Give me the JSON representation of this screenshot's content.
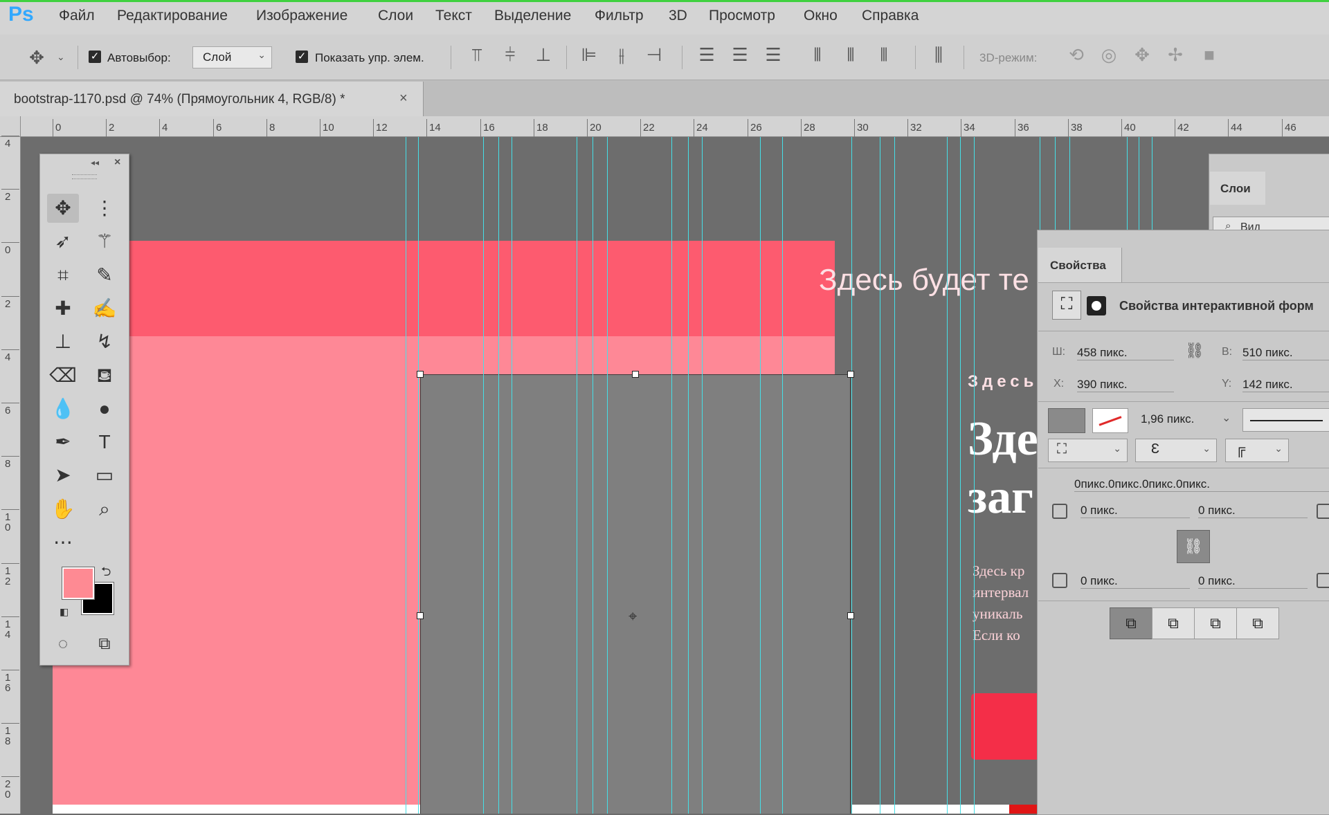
{
  "app": {
    "logo": "Ps"
  },
  "menu": [
    "Файл",
    "Редактирование",
    "Изображение",
    "Слои",
    "Текст",
    "Выделение",
    "Фильтр",
    "3D",
    "Просмотр",
    "Окно",
    "Справка"
  ],
  "options": {
    "autoselect_label": "Автовыбор:",
    "autoselect_checked": true,
    "layer_select_value": "Слой",
    "show_transform_label": "Показать упр. элем.",
    "show_transform_checked": true,
    "mode3d_label": "3D-режим:"
  },
  "document_tab": {
    "title": "bootstrap-1170.psd @ 74% (Прямоугольник 4, RGB/8) *",
    "close": "×"
  },
  "ruler_h_labels": [
    "0",
    "2",
    "4",
    "6",
    "8",
    "10",
    "12",
    "14",
    "16",
    "18",
    "20",
    "22",
    "24",
    "26",
    "28",
    "30",
    "32",
    "34",
    "36",
    "38",
    "40",
    "42",
    "44",
    "46"
  ],
  "ruler_v_labels": [
    "4",
    "2",
    "0",
    "2",
    "4",
    "6",
    "8",
    "10",
    "12",
    "14",
    "16",
    "18",
    "20"
  ],
  "document": {
    "header_text": "Здесь будет те",
    "small_caps": "Здесь",
    "heading_line1": "Зде",
    "heading_line2": "заг",
    "para_lines": [
      "Здесь кр",
      "интервал",
      "уникаль",
      "Если ко"
    ]
  },
  "colors": {
    "header_bg": "#fd5b6f",
    "body_bg": "#fe8896",
    "rectangle": "#7f7f7f",
    "guide": "#45e0e8",
    "foreground": "#fe8a93",
    "background": "#000000",
    "button": "#f42e48"
  },
  "layers_panel": {
    "tab": "Слои",
    "search": "Вид"
  },
  "properties_panel": {
    "tab": "Свойства",
    "subtitle": "Свойства интерактивной форм",
    "w_label": "Ш:",
    "w_value": "458 пикс.",
    "h_label": "В:",
    "h_value": "510 пикс.",
    "x_label": "X:",
    "x_value": "390 пикс.",
    "y_label": "Y:",
    "y_value": "142 пикс.",
    "stroke_width": "1,96 пикс.",
    "corners": "0пикс.0пикс.0пикс.0пикс.",
    "r_tl": "0 пикс.",
    "r_tr": "0 пикс.",
    "r_bl": "0 пикс.",
    "r_br": "0 пикс."
  }
}
